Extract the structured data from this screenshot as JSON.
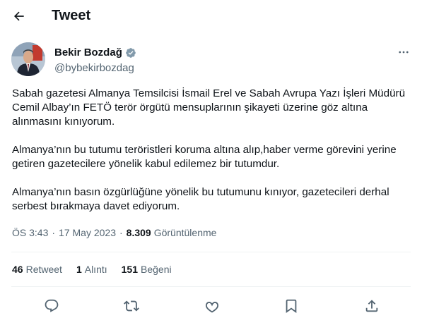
{
  "header": {
    "title": "Tweet"
  },
  "author": {
    "name": "Bekir Bozdağ",
    "handle": "@bybekirbozdag"
  },
  "tweet": {
    "paragraphs": [
      "Sabah gazetesi Almanya Temsilcisi İsmail Erel ve Sabah Avrupa Yazı İşleri Müdürü Cemil Albay’ın FETÖ terör örgütü mensuplarının şikayeti üzerine göz altına alınmasını kınıyorum.",
      "Almanya’nın bu tutumu teröristleri koruma altına alıp,haber verme görevini yerine getiren gazetecilere yönelik kabul edilemez bir tutumdur.",
      "Almanya’nın basın özgürlüğüne yönelik bu tutumunu kınıyor, gazetecileri derhal serbest bırakmaya davet ediyorum."
    ]
  },
  "meta": {
    "time": "ÖS 3:43",
    "date": "17 May 2023",
    "separator": "·",
    "views_count": "8.309",
    "views_label": "Görüntülenme"
  },
  "stats": {
    "retweets_count": "46",
    "retweets_label": "Retweet",
    "quotes_count": "1",
    "quotes_label": "Alıntı",
    "likes_count": "151",
    "likes_label": "Beğeni"
  },
  "icons": {
    "back": "arrow-left-icon",
    "verified": "verified-badge-icon",
    "more": "more-dots-icon",
    "reply": "reply-icon",
    "retweet": "retweet-icon",
    "like": "heart-icon",
    "bookmark": "bookmark-icon",
    "share": "share-icon"
  },
  "colors": {
    "verified": "#829aab",
    "text": "#0f1419",
    "secondary": "#536471",
    "divider": "#eff3f4"
  }
}
